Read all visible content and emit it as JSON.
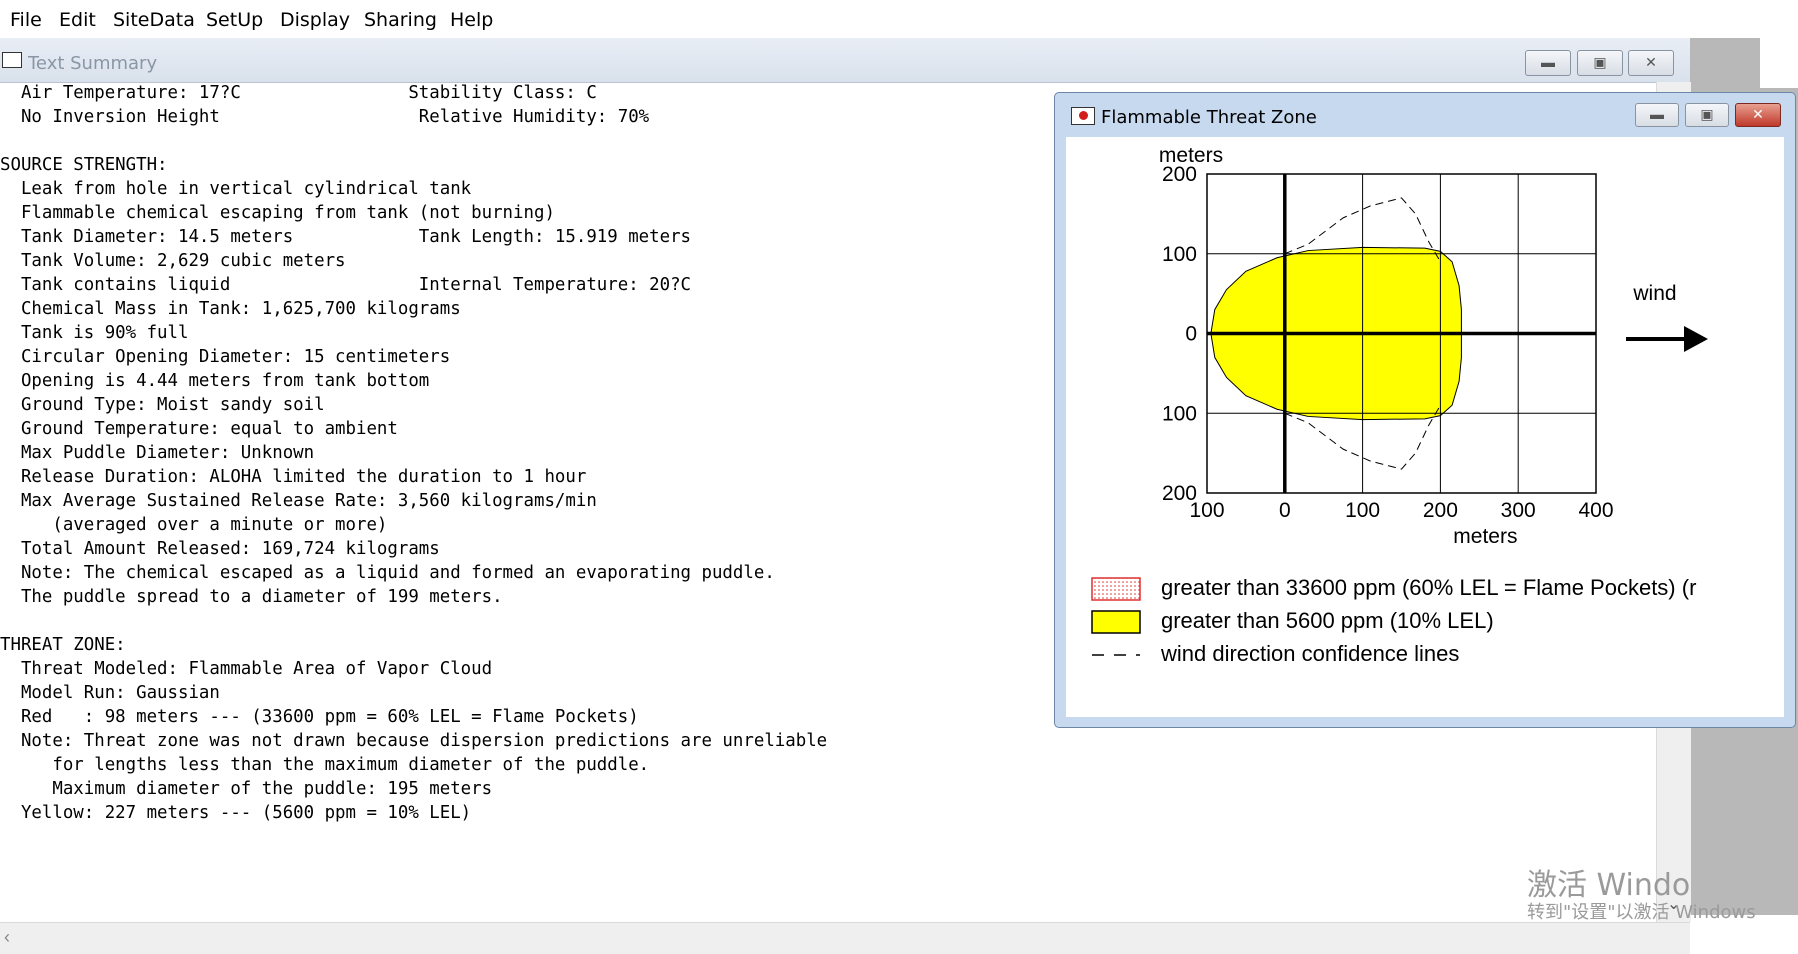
{
  "menu": [
    "File",
    "Edit",
    "SiteData",
    "SetUp",
    "Display",
    "Sharing",
    "Help"
  ],
  "text_summary": {
    "title": "Text Summary",
    "lines": [
      "  Air Temperature: 17?C                Stability Class: C",
      "  No Inversion Height                   Relative Humidity: 70%",
      "",
      "SOURCE STRENGTH:",
      "  Leak from hole in vertical cylindrical tank",
      "  Flammable chemical escaping from tank (not burning)",
      "  Tank Diameter: 14.5 meters            Tank Length: 15.919 meters",
      "  Tank Volume: 2,629 cubic meters",
      "  Tank contains liquid                  Internal Temperature: 20?C",
      "  Chemical Mass in Tank: 1,625,700 kilograms",
      "  Tank is 90% full",
      "  Circular Opening Diameter: 15 centimeters",
      "  Opening is 4.44 meters from tank bottom",
      "  Ground Type: Moist sandy soil",
      "  Ground Temperature: equal to ambient",
      "  Max Puddle Diameter: Unknown",
      "  Release Duration: ALOHA limited the duration to 1 hour",
      "  Max Average Sustained Release Rate: 3,560 kilograms/min",
      "     (averaged over a minute or more)",
      "  Total Amount Released: 169,724 kilograms",
      "  Note: The chemical escaped as a liquid and formed an evaporating puddle.",
      "  The puddle spread to a diameter of 199 meters.",
      "",
      "THREAT ZONE:",
      "  Threat Modeled: Flammable Area of Vapor Cloud",
      "  Model Run: Gaussian",
      "  Red   : 98 meters --- (33600 ppm = 60% LEL = Flame Pockets)",
      "  Note: Threat zone was not drawn because dispersion predictions are unreliable",
      "     for lengths less than the maximum diameter of the puddle.",
      "     Maximum diameter of the puddle: 195 meters",
      "  Yellow: 227 meters --- (5600 ppm = 10% LEL)"
    ]
  },
  "threat_zone": {
    "title": "Flammable Threat Zone",
    "wind_label": "wind",
    "chart_data": {
      "type": "area",
      "x_axis_label": "meters",
      "y_axis_label": "meters",
      "xlim": [
        -100,
        400
      ],
      "ylim": [
        -200,
        200
      ],
      "x_tick_labels": [
        "100",
        "0",
        "100",
        "200",
        "300",
        "400"
      ],
      "y_tick_labels": [
        "200",
        "100",
        "0",
        "100",
        "200"
      ],
      "grid": true,
      "colors": {
        "yellow_zone": "#ffff00",
        "red_zone": "#ff0000"
      },
      "yellow_zone_outline": [
        [
          -95,
          0
        ],
        [
          -90,
          30
        ],
        [
          -75,
          55
        ],
        [
          -50,
          78
        ],
        [
          -10,
          95
        ],
        [
          30,
          104
        ],
        [
          100,
          108
        ],
        [
          180,
          107
        ],
        [
          200,
          103
        ],
        [
          215,
          90
        ],
        [
          224,
          60
        ],
        [
          227,
          30
        ],
        [
          227,
          0
        ],
        [
          227,
          -30
        ],
        [
          224,
          -60
        ],
        [
          215,
          -90
        ],
        [
          200,
          -103
        ],
        [
          180,
          -107
        ],
        [
          100,
          -108
        ],
        [
          30,
          -104
        ],
        [
          -10,
          -95
        ],
        [
          -50,
          -78
        ],
        [
          -75,
          -55
        ],
        [
          -90,
          -30
        ],
        [
          -95,
          0
        ]
      ],
      "confidence_line_upper": [
        [
          0,
          100
        ],
        [
          30,
          112
        ],
        [
          75,
          145
        ],
        [
          110,
          160
        ],
        [
          150,
          170
        ],
        [
          168,
          150
        ],
        [
          185,
          115
        ],
        [
          200,
          90
        ]
      ],
      "confidence_line_lower": [
        [
          0,
          -100
        ],
        [
          30,
          -112
        ],
        [
          75,
          -145
        ],
        [
          110,
          -160
        ],
        [
          150,
          -170
        ],
        [
          168,
          -150
        ],
        [
          185,
          -115
        ],
        [
          200,
          -90
        ]
      ],
      "legend": [
        {
          "swatch": "dotted-red",
          "label": "greater than 33600 ppm (60% LEL = Flame Pockets) (r"
        },
        {
          "swatch": "yellow",
          "label": "greater than 5600 ppm (10% LEL)"
        },
        {
          "swatch": "dashed",
          "label": "wind direction confidence lines"
        }
      ]
    }
  },
  "watermark": {
    "line1": "激活 Windo",
    "line2": "转到\"设置\"以激活 Windows"
  }
}
